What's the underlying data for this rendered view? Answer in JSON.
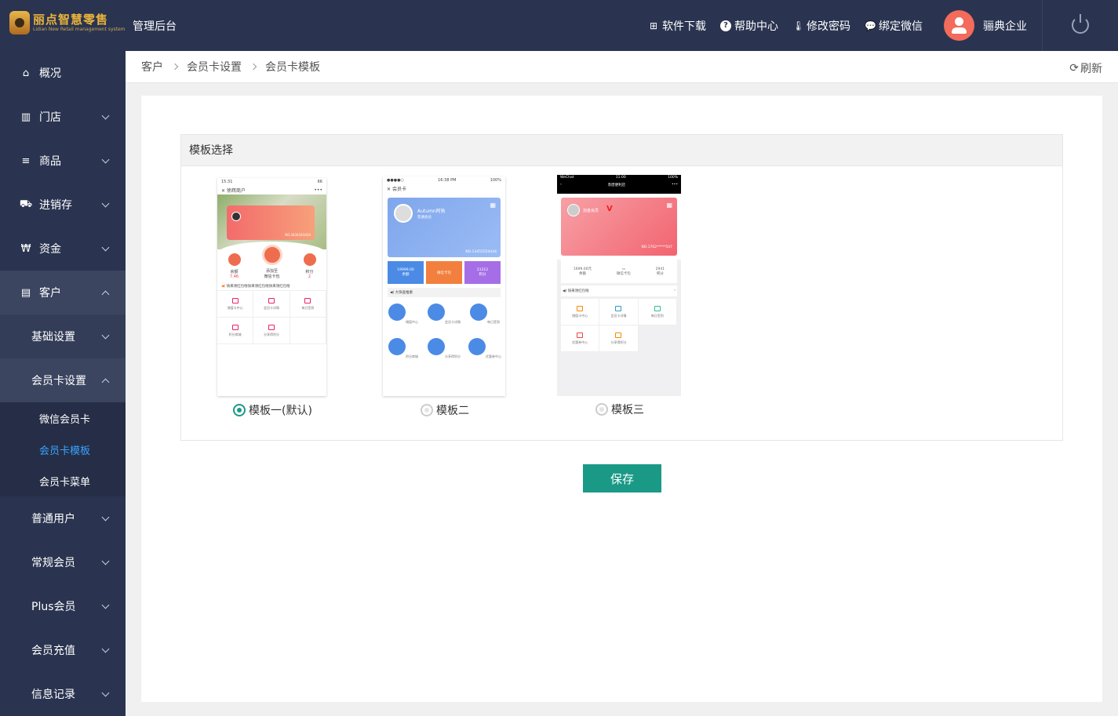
{
  "header": {
    "logo_title": "丽点智慧零售",
    "logo_subtitle": "Lidian New Retail management system",
    "admin_title": "管理后台",
    "nav": [
      {
        "label": "软件下载",
        "icon": "app-download-icon"
      },
      {
        "label": "帮助中心",
        "icon": "help-icon"
      },
      {
        "label": "修改密码",
        "icon": "thermometer-key-icon"
      },
      {
        "label": "绑定微信",
        "icon": "wechat-icon"
      }
    ],
    "username": "骊典企业"
  },
  "sidebar": {
    "items": [
      {
        "label": "概况",
        "icon": "home-icon"
      },
      {
        "label": "门店",
        "icon": "building-icon"
      },
      {
        "label": "商品",
        "icon": "list-icon"
      },
      {
        "label": "进销存",
        "icon": "truck-icon"
      },
      {
        "label": "资金",
        "icon": "won-icon"
      },
      {
        "label": "客户",
        "icon": "id-card-icon"
      }
    ],
    "sub_items": [
      "基础设置",
      "会员卡设置"
    ],
    "leaves": [
      "微信会员卡",
      "会员卡模板",
      "会员卡菜单"
    ],
    "more": [
      "普通用户",
      "常规会员",
      "Plus会员",
      "会员充值",
      "信息记录"
    ]
  },
  "breadcrumb": [
    "客户",
    "会员卡设置",
    "会员卡模板"
  ],
  "refresh_label": "刷新",
  "panel_title": "模板选择",
  "templates": [
    {
      "label": "模板一(默认)",
      "selected": true,
      "phone": {
        "time": "15:31",
        "battery": "66",
        "title": "徐辉商户",
        "card_no": "NO.3434343434",
        "stat_left": "余额",
        "stat_left_val": "7.46",
        "stat_mid": "添加至",
        "stat_mid2": "微信卡包",
        "stat_right": "积分",
        "stat_right_val": "2",
        "notice": "快来领红包啦快来领红包啦快来领红包啦",
        "cells": [
          "储值卡中心",
          "会员卡详情",
          "每日签到",
          "积分商城",
          "分享得积分"
        ]
      }
    },
    {
      "label": "模板二",
      "selected": false,
      "phone": {
        "time": "16:38 PM",
        "battery": "100%",
        "title": "会员卡",
        "name": "Autumn阿秋",
        "level": "普通会员",
        "card_no": "NO.13455554444",
        "balance": "19999.00",
        "balance_label": "余额",
        "wallet_label": "微信卡包",
        "points": "21312",
        "points_label": "积分",
        "notice": "大快查推素",
        "icons": [
          "储值中心",
          "会员卡详情",
          "每日签到",
          "积分商城",
          "分享得积分",
          "优惠券中心"
        ]
      }
    },
    {
      "label": "模板三",
      "selected": false,
      "phone": {
        "carrier": "WeChat",
        "time": "11:00",
        "battery": "100%",
        "title": "赤厝便利店",
        "member": "加金会员",
        "card_no": "NO.1702*****547",
        "stat_left": "1699.00元",
        "stat_left2": "余额",
        "stat_mid": "微信卡包",
        "stat_right": "2941",
        "stat_right2": "积分",
        "notice": "快来领红包啦",
        "cells": [
          "储值卡中心",
          "会员卡详情",
          "每日签到",
          "优惠券中心",
          "分享得积分"
        ]
      }
    }
  ],
  "save_label": "保存",
  "colors": {
    "sidebar": "#2a3450",
    "accent": "#1a9a86",
    "active_link": "#3aa1ff",
    "avatar": "#f26b5b"
  }
}
